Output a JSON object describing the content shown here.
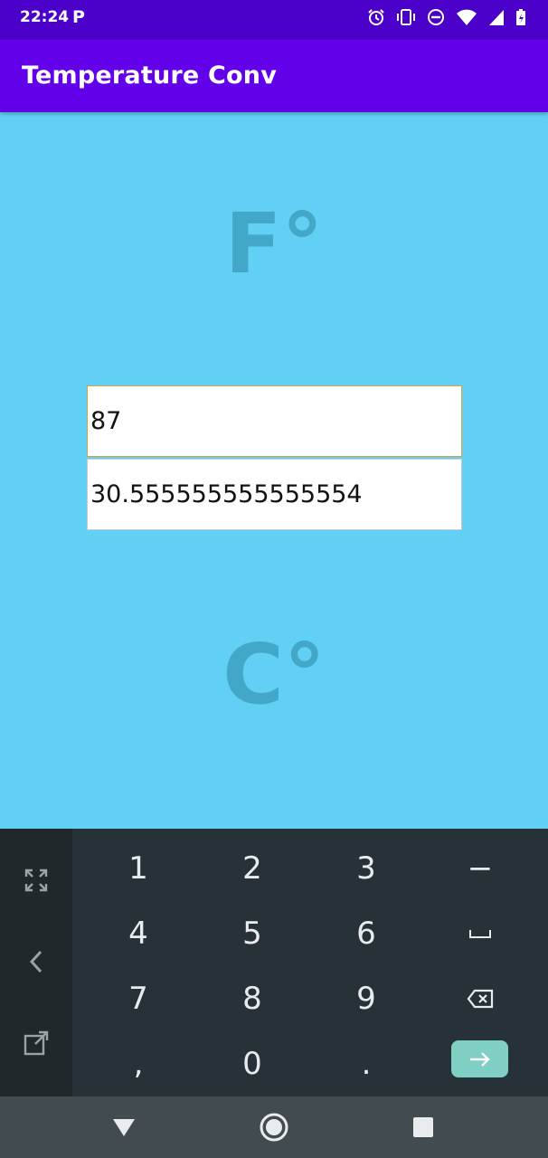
{
  "status_bar": {
    "time": "22:24",
    "notification_icon": "p-letter-icon",
    "icons": [
      "alarm-icon",
      "vibrate-icon",
      "do-not-disturb-icon",
      "wifi-icon",
      "signal-icon",
      "battery-icon"
    ]
  },
  "app_bar": {
    "title": "Temperature Conv",
    "color": "#6200ea"
  },
  "content": {
    "background": "#62d0f4",
    "fahrenheit_label": "F°",
    "celsius_label": "C°",
    "fahrenheit_value": "87",
    "celsius_value": "30.555555555555554"
  },
  "keyboard": {
    "side_keys": [
      "fullscreen-icon",
      "chevron-left-icon",
      "open-external-icon"
    ],
    "rows": [
      [
        "1",
        "2",
        "3",
        "−"
      ],
      [
        "4",
        "5",
        "6",
        "␣"
      ],
      [
        "7",
        "8",
        "9",
        "⌫"
      ],
      [
        ",",
        "0",
        ".",
        "→"
      ]
    ]
  },
  "nav_bar": {
    "buttons": [
      "back-icon",
      "home-icon",
      "recents-icon"
    ]
  }
}
